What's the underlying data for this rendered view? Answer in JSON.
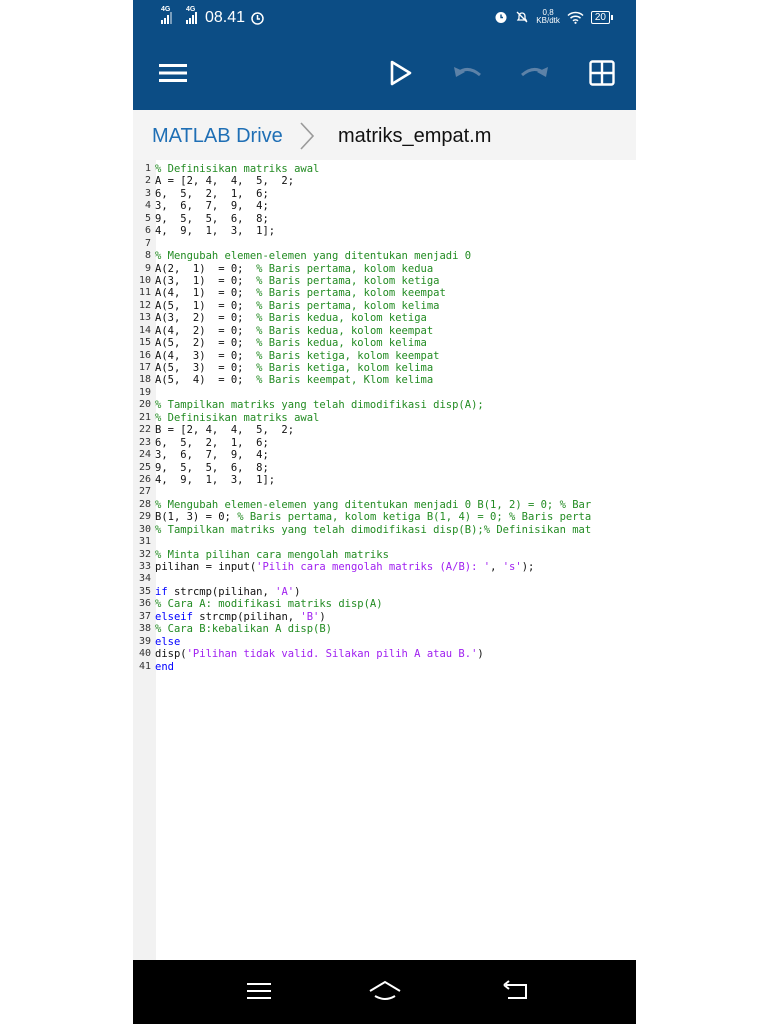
{
  "status_bar": {
    "sim1": "4G",
    "sim2": "4G",
    "time": "08.41",
    "net_speed_value": "0,8",
    "net_speed_unit": "KB/dtk",
    "battery": "20"
  },
  "breadcrumb": {
    "root": "MATLAB Drive",
    "file": "matriks_empat.m"
  },
  "code": [
    {
      "n": "1",
      "parts": [
        {
          "t": "% Definisikan matriks awal",
          "c": "comment"
        }
      ]
    },
    {
      "n": "2",
      "parts": [
        {
          "t": "A = [2, 4,  4,  5,  2;",
          "c": "plain"
        }
      ]
    },
    {
      "n": "3",
      "parts": [
        {
          "t": "6,  5,  2,  1,  6;",
          "c": "plain"
        }
      ]
    },
    {
      "n": "4",
      "parts": [
        {
          "t": "3,  6,  7,  9,  4;",
          "c": "plain"
        }
      ]
    },
    {
      "n": "5",
      "parts": [
        {
          "t": "9,  5,  5,  6,  8;",
          "c": "plain"
        }
      ]
    },
    {
      "n": "6",
      "parts": [
        {
          "t": "4,  9,  1,  3,  1];",
          "c": "plain"
        }
      ]
    },
    {
      "n": "7",
      "parts": []
    },
    {
      "n": "8",
      "parts": [
        {
          "t": "% Mengubah elemen-elemen yang ditentukan menjadi 0",
          "c": "comment"
        }
      ]
    },
    {
      "n": "9",
      "parts": [
        {
          "t": "A(2,  1)  = 0;  ",
          "c": "plain"
        },
        {
          "t": "% Baris pertama, kolom kedua",
          "c": "comment"
        }
      ]
    },
    {
      "n": "10",
      "parts": [
        {
          "t": "A(3,  1)  = 0;  ",
          "c": "plain"
        },
        {
          "t": "% Baris pertama, kolom ketiga",
          "c": "comment"
        }
      ]
    },
    {
      "n": "11",
      "parts": [
        {
          "t": "A(4,  1)  = 0;  ",
          "c": "plain"
        },
        {
          "t": "% Baris pertama, kolom keempat",
          "c": "comment"
        }
      ]
    },
    {
      "n": "12",
      "parts": [
        {
          "t": "A(5,  1)  = 0;  ",
          "c": "plain"
        },
        {
          "t": "% Baris pertama, kolom kelima",
          "c": "comment"
        }
      ]
    },
    {
      "n": "13",
      "parts": [
        {
          "t": "A(3,  2)  = 0;  ",
          "c": "plain"
        },
        {
          "t": "% Baris kedua, kolom ketiga",
          "c": "comment"
        }
      ]
    },
    {
      "n": "14",
      "parts": [
        {
          "t": "A(4,  2)  = 0;  ",
          "c": "plain"
        },
        {
          "t": "% Baris kedua, kolom keempat",
          "c": "comment"
        }
      ]
    },
    {
      "n": "15",
      "parts": [
        {
          "t": "A(5,  2)  = 0;  ",
          "c": "plain"
        },
        {
          "t": "% Baris kedua, kolom kelima",
          "c": "comment"
        }
      ]
    },
    {
      "n": "16",
      "parts": [
        {
          "t": "A(4,  3)  = 0;  ",
          "c": "plain"
        },
        {
          "t": "% Baris ketiga, kolom keempat",
          "c": "comment"
        }
      ]
    },
    {
      "n": "17",
      "parts": [
        {
          "t": "A(5,  3)  = 0;  ",
          "c": "plain"
        },
        {
          "t": "% Baris ketiga, kolom kelima",
          "c": "comment"
        }
      ]
    },
    {
      "n": "18",
      "parts": [
        {
          "t": "A(5,  4)  = 0;  ",
          "c": "plain"
        },
        {
          "t": "% Baris keempat, Klom kelima",
          "c": "comment"
        }
      ]
    },
    {
      "n": "19",
      "parts": []
    },
    {
      "n": "20",
      "parts": [
        {
          "t": "% Tampilkan matriks yang telah dimodifikasi disp(A);",
          "c": "comment"
        }
      ]
    },
    {
      "n": "21",
      "parts": [
        {
          "t": "% Definisikan matriks awal",
          "c": "comment"
        }
      ]
    },
    {
      "n": "22",
      "parts": [
        {
          "t": "B = [2, 4,  4,  5,  2;",
          "c": "plain"
        }
      ]
    },
    {
      "n": "23",
      "parts": [
        {
          "t": "6,  5,  2,  1,  6;",
          "c": "plain"
        }
      ]
    },
    {
      "n": "24",
      "parts": [
        {
          "t": "3,  6,  7,  9,  4;",
          "c": "plain"
        }
      ]
    },
    {
      "n": "25",
      "parts": [
        {
          "t": "9,  5,  5,  6,  8;",
          "c": "plain"
        }
      ]
    },
    {
      "n": "26",
      "parts": [
        {
          "t": "4,  9,  1,  3,  1];",
          "c": "plain"
        }
      ]
    },
    {
      "n": "27",
      "parts": []
    },
    {
      "n": "28",
      "parts": [
        {
          "t": "% Mengubah elemen-elemen yang ditentukan menjadi 0 B(1, 2) = 0; % Bar",
          "c": "comment"
        }
      ]
    },
    {
      "n": "29",
      "parts": [
        {
          "t": "B(1, 3) = 0; ",
          "c": "plain"
        },
        {
          "t": "% Baris pertama, kolom ketiga B(1, 4) = 0; % Baris perta",
          "c": "comment"
        }
      ]
    },
    {
      "n": "30",
      "parts": [
        {
          "t": "% Tampilkan matriks yang telah dimodifikasi disp(B);% Definisikan mat",
          "c": "comment"
        }
      ]
    },
    {
      "n": "31",
      "parts": []
    },
    {
      "n": "32",
      "parts": [
        {
          "t": "% Minta pilihan cara mengolah matriks",
          "c": "comment"
        }
      ]
    },
    {
      "n": "33",
      "parts": [
        {
          "t": "pilihan = input(",
          "c": "plain"
        },
        {
          "t": "'Pilih cara mengolah matriks (A/B): '",
          "c": "string"
        },
        {
          "t": ", ",
          "c": "plain"
        },
        {
          "t": "'s'",
          "c": "string"
        },
        {
          "t": ");",
          "c": "plain"
        }
      ]
    },
    {
      "n": "34",
      "parts": []
    },
    {
      "n": "35",
      "parts": [
        {
          "t": "if",
          "c": "keyword"
        },
        {
          "t": " strcmp(pilihan, ",
          "c": "plain"
        },
        {
          "t": "'A'",
          "c": "string"
        },
        {
          "t": ")",
          "c": "plain"
        }
      ]
    },
    {
      "n": "36",
      "parts": [
        {
          "t": "% Cara A: modifikasi matriks disp(A)",
          "c": "comment"
        }
      ]
    },
    {
      "n": "37",
      "parts": [
        {
          "t": "elseif",
          "c": "keyword"
        },
        {
          "t": " strcmp(pilihan, ",
          "c": "plain"
        },
        {
          "t": "'B'",
          "c": "string"
        },
        {
          "t": ")",
          "c": "plain"
        }
      ]
    },
    {
      "n": "38",
      "parts": [
        {
          "t": "% Cara B:kebalikan A disp(B)",
          "c": "comment"
        }
      ]
    },
    {
      "n": "39",
      "parts": [
        {
          "t": "else",
          "c": "keyword"
        }
      ]
    },
    {
      "n": "40",
      "parts": [
        {
          "t": "disp(",
          "c": "plain"
        },
        {
          "t": "'Pilihan tidak valid. Silakan pilih A atau B.'",
          "c": "string"
        },
        {
          "t": ")",
          "c": "plain"
        }
      ]
    },
    {
      "n": "41",
      "parts": [
        {
          "t": "end",
          "c": "keyword"
        }
      ]
    }
  ],
  "icons": {
    "menu": "hamburger-menu-icon",
    "run": "play-icon",
    "undo": "undo-icon",
    "redo": "redo-icon",
    "view": "grid-icon",
    "nav_recent": "menu-lines-icon",
    "nav_home": "home-icon",
    "nav_back": "back-icon"
  },
  "colors": {
    "app_bar": "#0c4d85",
    "breadcrumb_link": "#1f6fb5",
    "comment": "#228b22",
    "keyword": "#0000ff",
    "string": "#a020f0"
  }
}
